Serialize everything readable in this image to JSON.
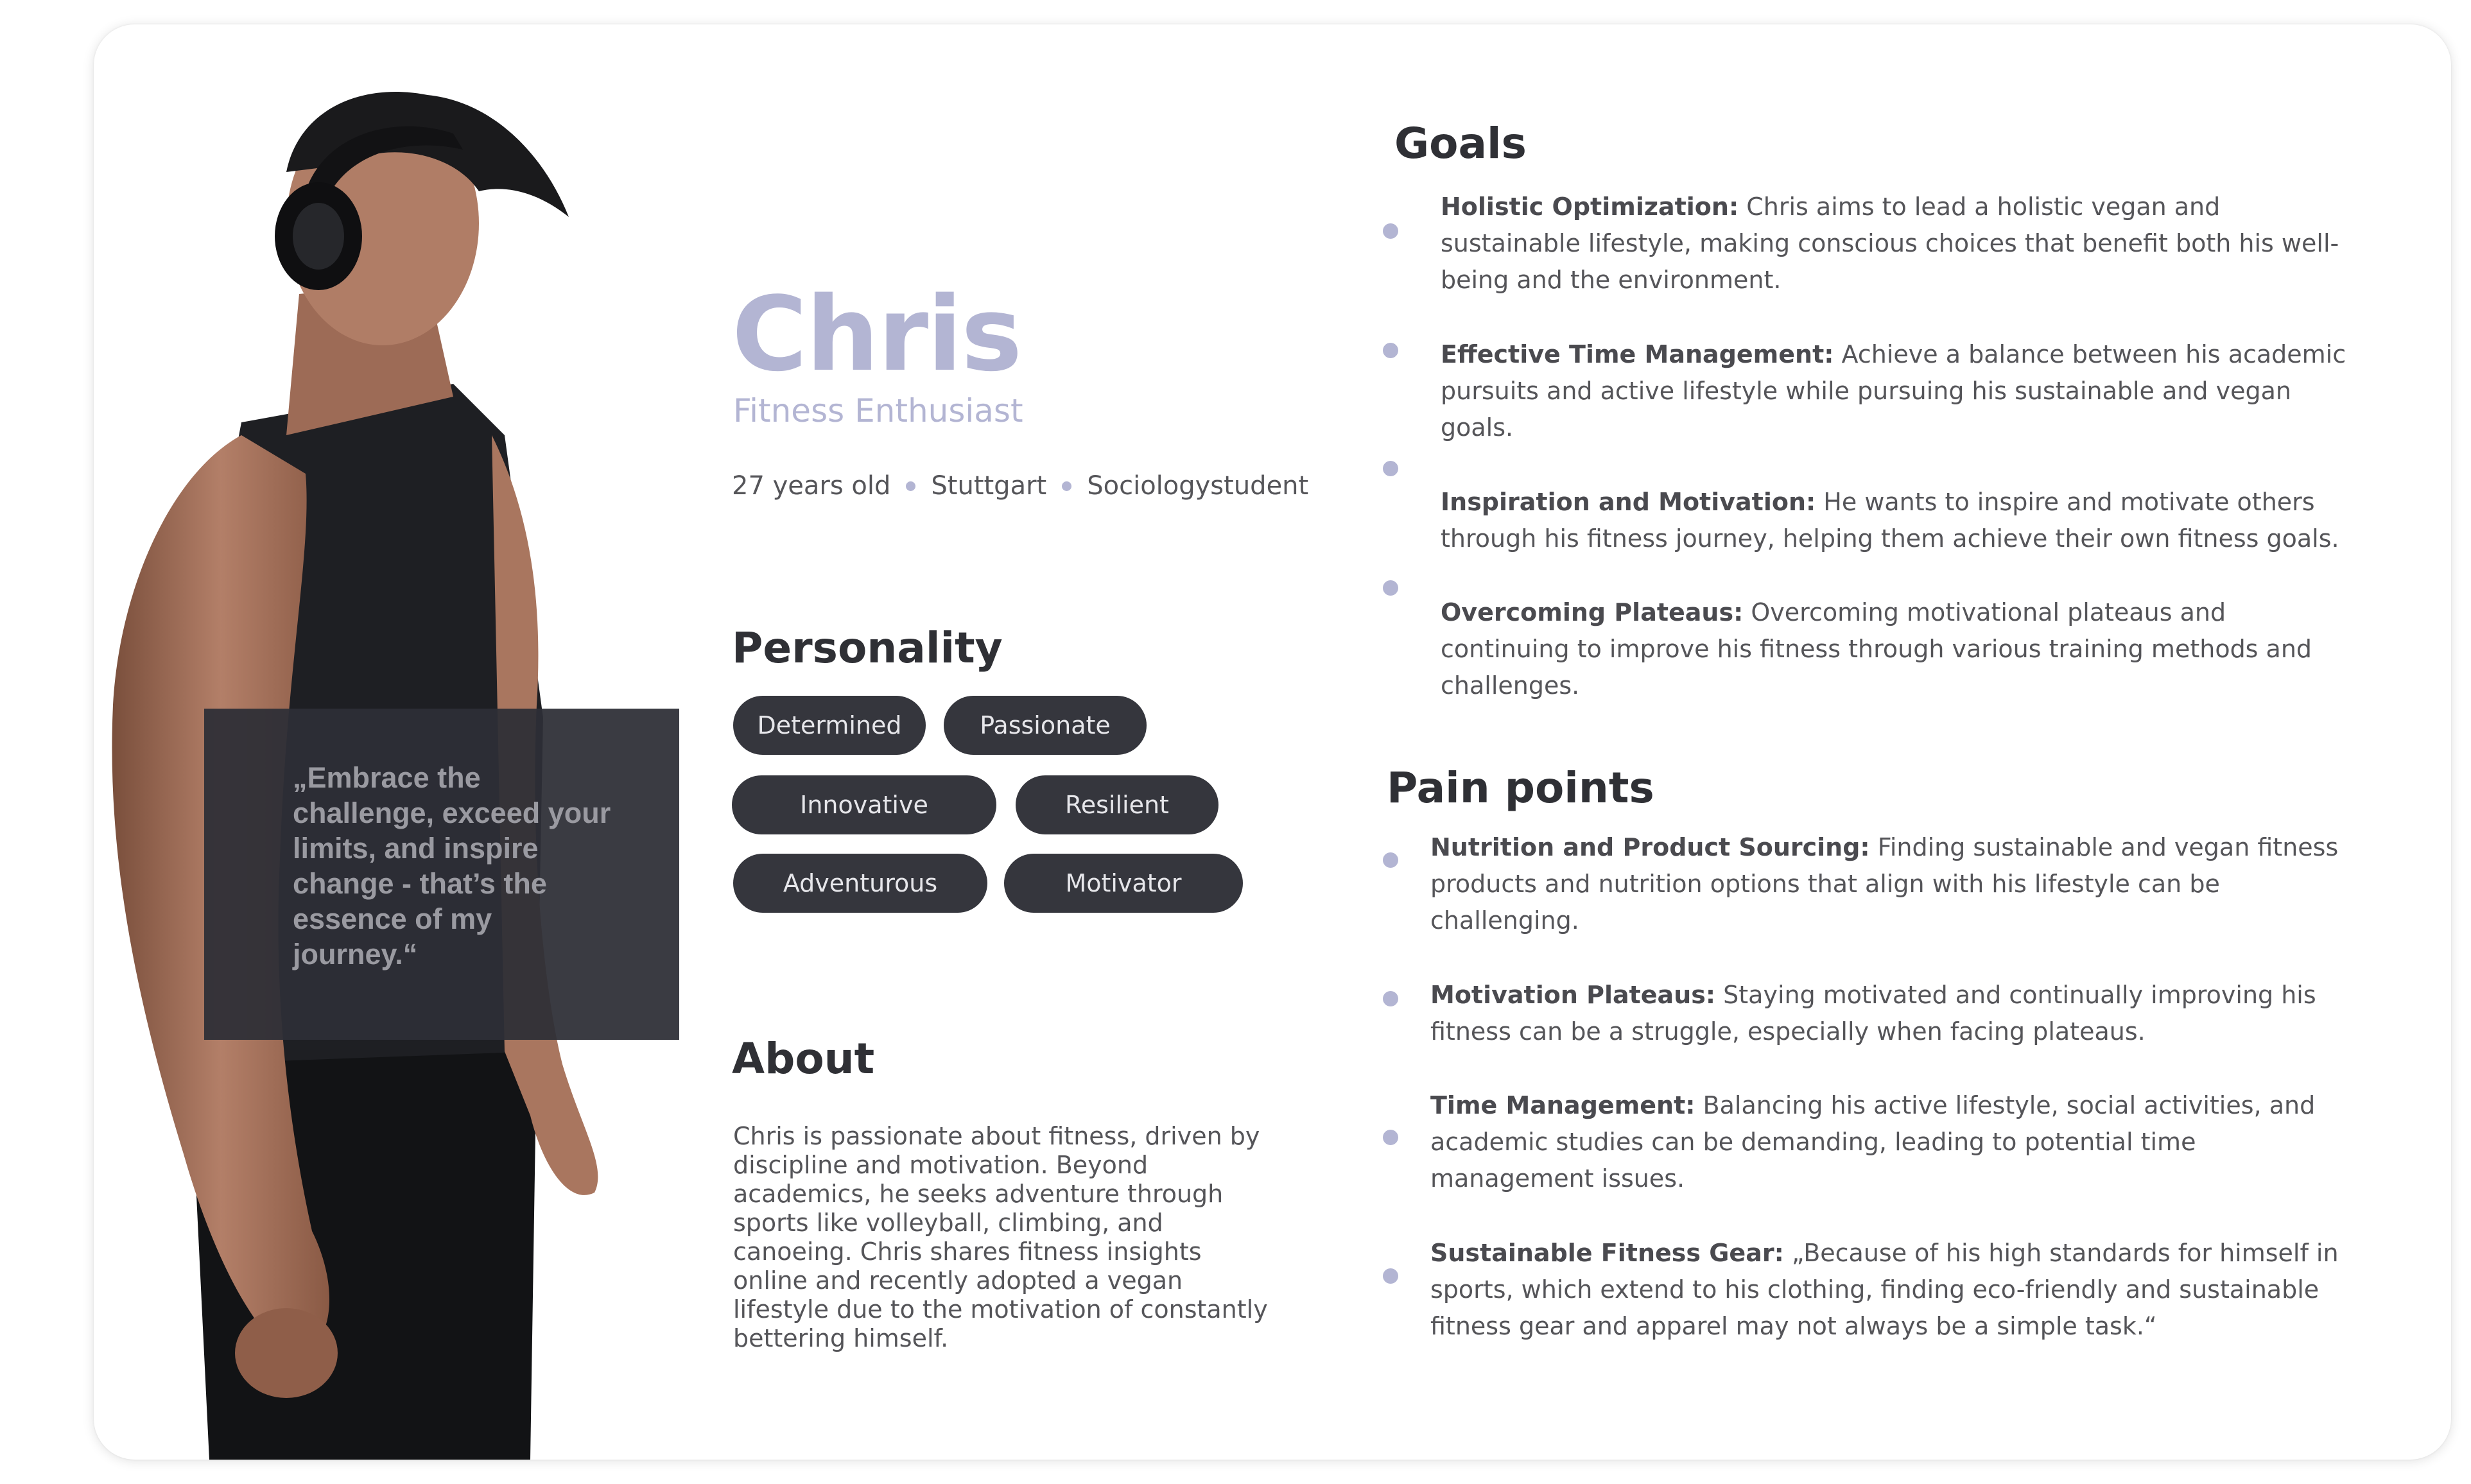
{
  "persona": {
    "name": "Chris",
    "role": "Fitness Enthusiast",
    "meta": [
      "27 years old",
      "Stuttgart",
      "Sociologystudent"
    ]
  },
  "quote": "„Embrace the challenge, exceed your limits, and inspire change - that’s the essence of my journey.“",
  "personality": {
    "title": "Personality",
    "traits": [
      "Determined",
      "Passionate",
      "Innovative",
      "Resilient",
      "Adventurous",
      "Motivator"
    ]
  },
  "about": {
    "title": "About",
    "text": "Chris is passionate about fitness, driven by discipline and motivation. Beyond academics, he seeks adventure through sports like volleyball, climbing, and canoeing. Chris shares fitness insights online and recently adopted a vegan lifestyle due to the motivation of constantly bettering himself."
  },
  "goals": {
    "title": "Goals",
    "items": [
      {
        "label": "Holistic Optimization:",
        "text": " Chris aims to lead a holistic vegan and sustainable lifestyle, making conscious choices that benefit both his well-being and the environment."
      },
      {
        "label": "Effective Time Management:",
        "text": " Achieve a balance between his academic pursuits and active lifestyle while pursuing his sustainable and vegan goals."
      },
      {
        "label": "Inspiration and Motivation:",
        "text": " He wants to inspire and motivate others through his fitness journey, helping them achieve their own fitness goals."
      },
      {
        "label": "Overcoming Plateaus:",
        "text": " Overcoming motivational plateaus and continuing to improve his fitness through various training methods and challenges."
      }
    ]
  },
  "pain_points": {
    "title": "Pain points",
    "items": [
      {
        "label": "Nutrition and Product Sourcing:",
        "text": " Finding sustainable and vegan fitness products and nutrition options that align with his lifestyle can be challenging."
      },
      {
        "label": "Motivation Plateaus:",
        "text": " Staying motivated and continually improving his fitness can be a struggle, especially when facing plateaus."
      },
      {
        "label": "Time Management:",
        "text": " Balancing his active lifestyle, social activities, and academic studies can be demanding, leading to potential time management issues."
      },
      {
        "label": "Sustainable Fitness Gear:",
        "text": "  „Because of his high standards for himself in sports, which extend to his clothing, finding eco-friendly and sustainable fitness gear and apparel may not always be a simple task.“"
      }
    ]
  },
  "colors": {
    "accent": "#b3b5d3",
    "chip": "#35363d",
    "heading": "#2f3035",
    "text": "#555559"
  }
}
